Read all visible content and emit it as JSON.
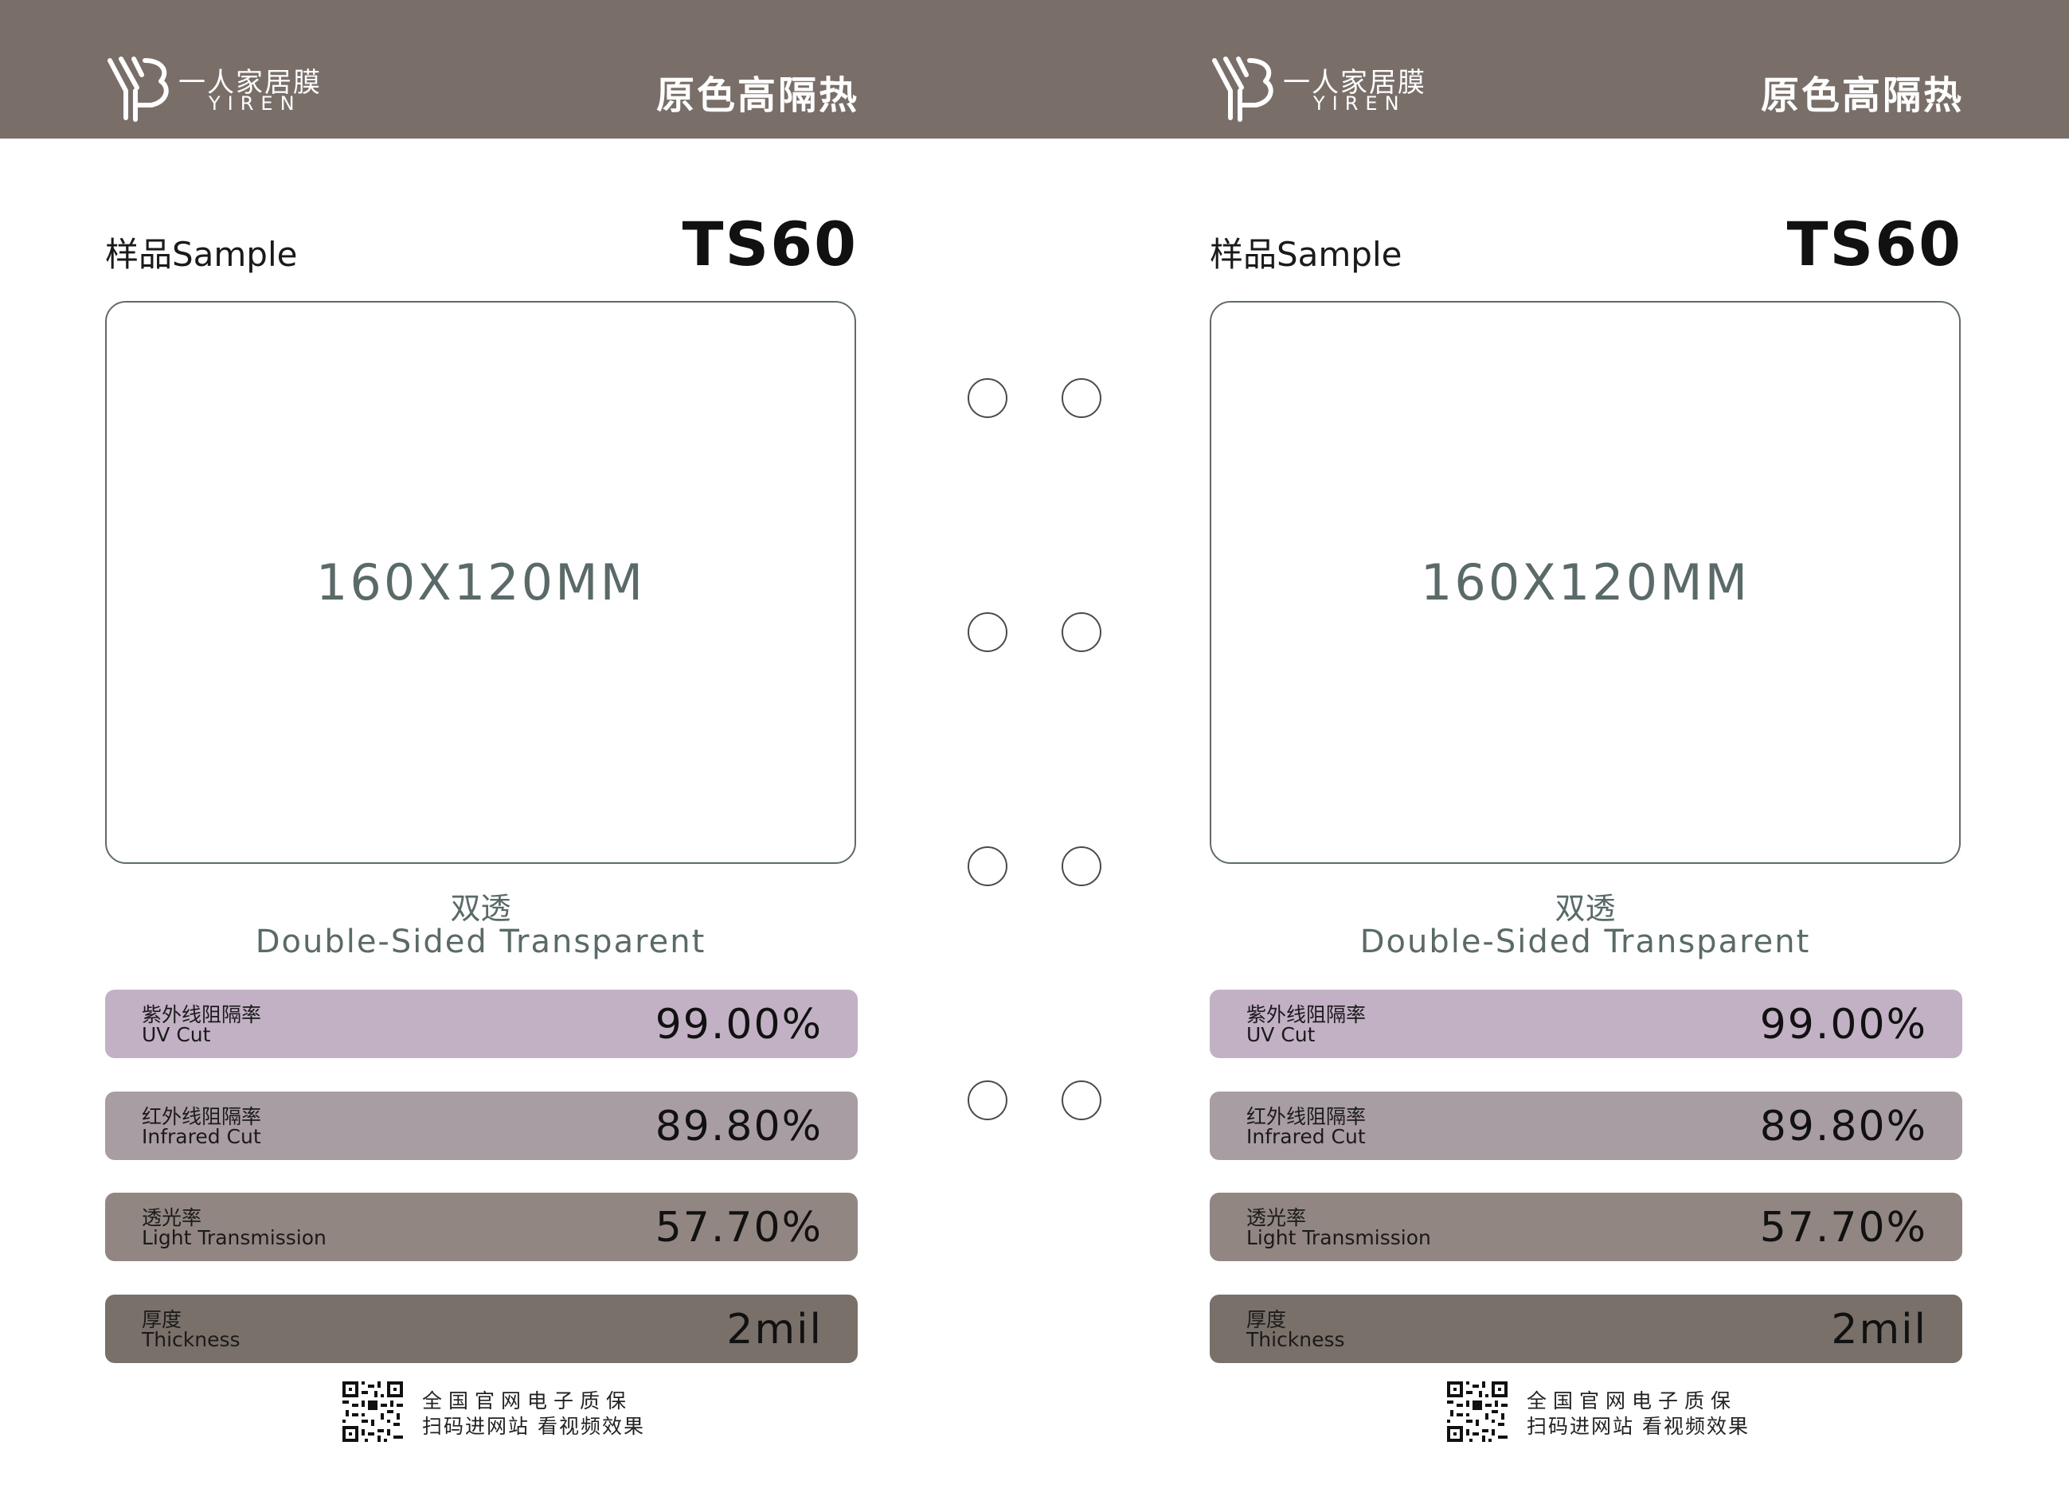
{
  "brand": {
    "name_cn": "一人家居膜",
    "name_en": "YIREN"
  },
  "header_title": "原色高隔热",
  "sample_label": "样品Sample",
  "model": "TS60",
  "sample_size": "160X120MM",
  "film_type": {
    "cn": "双透",
    "en": "Double-Sided Transparent"
  },
  "metrics": [
    {
      "cn": "紫外线阻隔率",
      "en": "UV Cut",
      "value": "99.00%",
      "color": "#c2b0c5"
    },
    {
      "cn": "红外线阻隔率",
      "en": "Infrared Cut",
      "value": "89.80%",
      "color": "#a99da4"
    },
    {
      "cn": "透光率",
      "en": "Light Transmission",
      "value": "57.70%",
      "color": "#918681"
    },
    {
      "cn": "厚度",
      "en": "Thickness",
      "value": "2mil",
      "color": "#7a706a"
    }
  ],
  "footer": {
    "line1": "全国官网电子质保",
    "line2": "扫码进网站 看视频效果"
  },
  "colors": {
    "header_bg": "#7a6f68",
    "sample_text": "#5a6a68"
  },
  "icons": [
    "yiren-logo-icon",
    "qr-code-icon",
    "binder-hole"
  ]
}
